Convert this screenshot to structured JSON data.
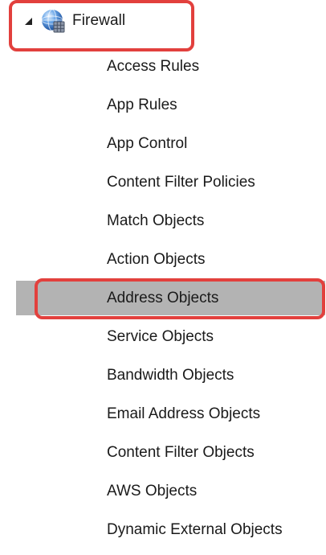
{
  "tree": {
    "parent": {
      "label": "Firewall",
      "expanded": true,
      "icon": "globe-icon",
      "expander_icon": "triangle-expanded-icon"
    },
    "selected_item": "Address Objects",
    "highlight_color": "#e2403d",
    "selection_color": "#b3b3b3",
    "children": [
      {
        "label": "Access Rules"
      },
      {
        "label": "App Rules"
      },
      {
        "label": "App Control"
      },
      {
        "label": "Content Filter Policies"
      },
      {
        "label": "Match Objects"
      },
      {
        "label": "Action Objects"
      },
      {
        "label": "Address Objects"
      },
      {
        "label": "Service Objects"
      },
      {
        "label": "Bandwidth Objects"
      },
      {
        "label": "Email Address Objects"
      },
      {
        "label": "Content Filter Objects"
      },
      {
        "label": "AWS Objects"
      },
      {
        "label": "Dynamic External Objects"
      }
    ]
  }
}
